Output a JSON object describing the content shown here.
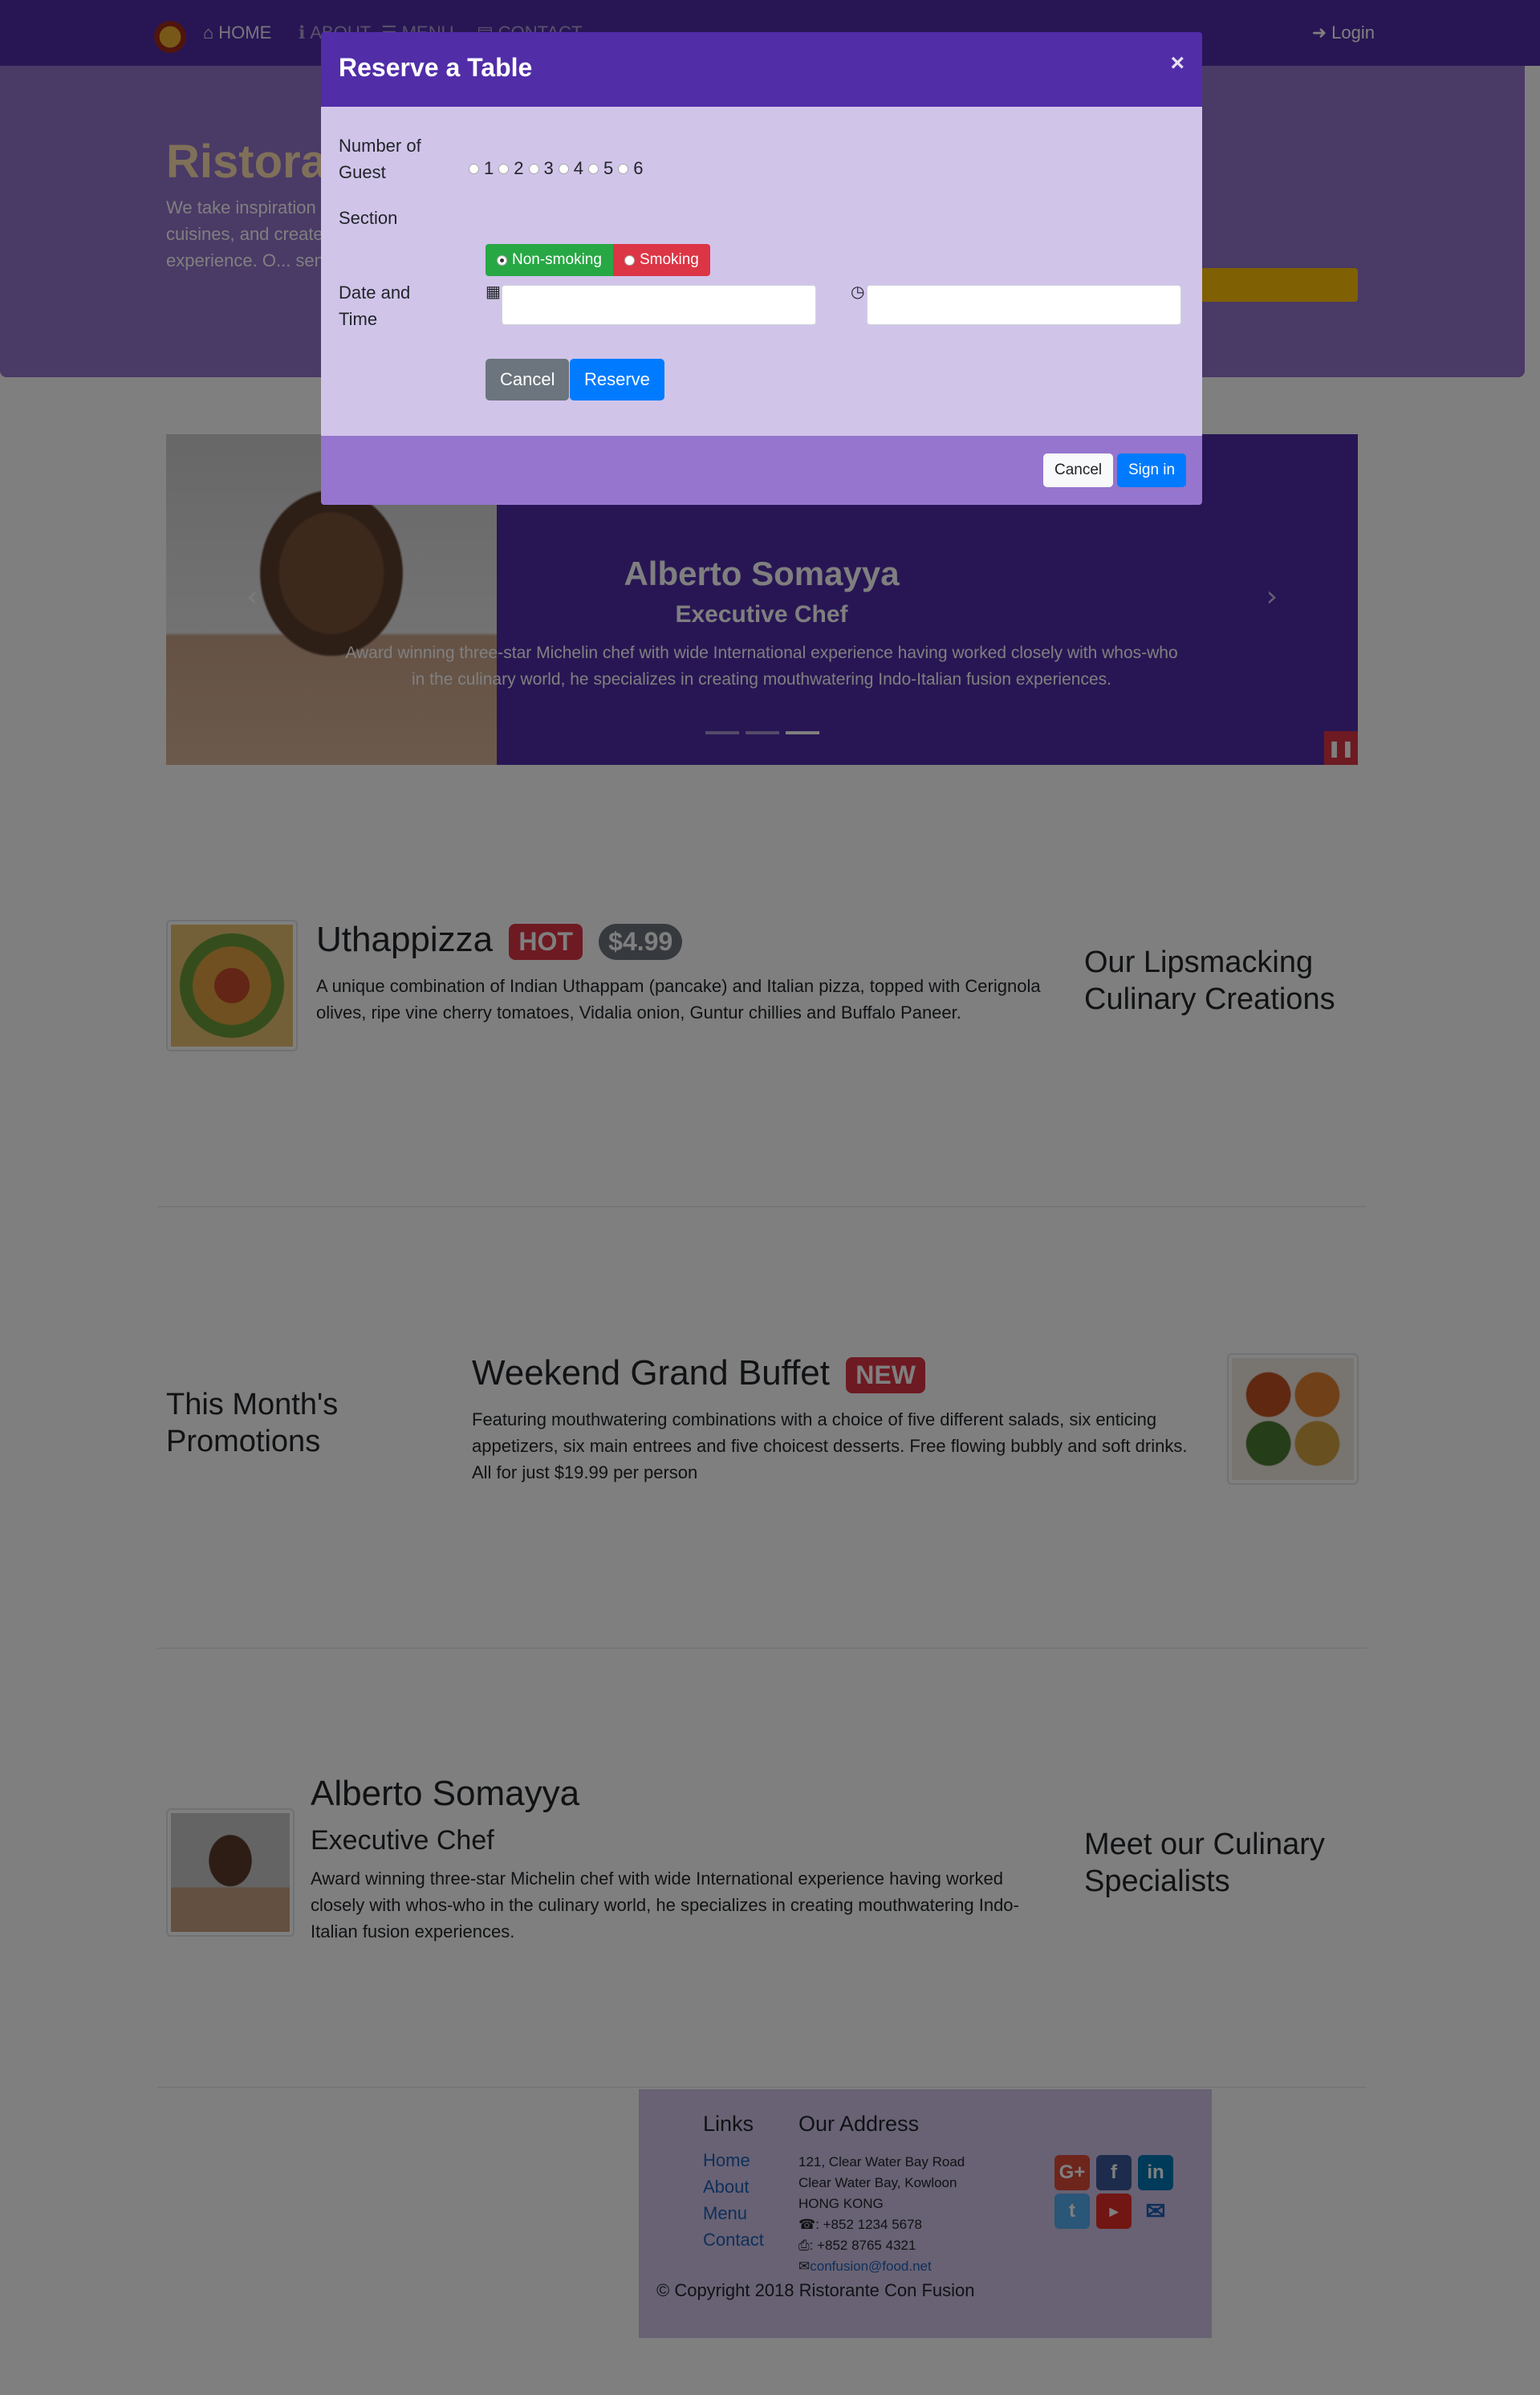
{
  "navbar": {
    "items": [
      {
        "label": "HOME",
        "icon": "home-icon"
      },
      {
        "label": "ABOUT",
        "icon": "info-icon"
      },
      {
        "label": "MENU",
        "icon": "list-icon"
      },
      {
        "label": "CONTACT",
        "icon": "address-card-icon"
      }
    ],
    "login": "Login"
  },
  "jumbotron": {
    "title": "Ristoran",
    "text": "We take inspiration from the World's best cuisines, and create a unique fusion experience. O... senses!"
  },
  "carousel": {
    "name": "Alberto Somayya",
    "role": "Executive Chef",
    "description": "Award winning three-star Michelin chef with wide International experience having worked closely with whos-who in the culinary world, he specializes in creating mouthwatering Indo-Italian fusion experiences.",
    "active_slide_index": 2,
    "slide_count": 3
  },
  "dish": {
    "name": "Uthappizza",
    "badge": "HOT",
    "price": "$4.99",
    "description": "A unique combination of Indian Uthappam (pancake) and Italian pizza, topped with Cerignola olives, ripe vine cherry tomatoes, Vidalia onion, Guntur chillies and Buffalo Paneer.",
    "side_heading": "Our Lipsmacking Culinary Creations"
  },
  "promotion": {
    "side_heading": "This Month's Promotions",
    "name": "Weekend Grand Buffet",
    "badge": "NEW",
    "description": "Featuring mouthwatering combinations with a choice of five different salads, six enticing appetizers, six main entrees and five choicest desserts. Free flowing bubbly and soft drinks. All for just $19.99 per person"
  },
  "leader": {
    "name": "Alberto Somayya",
    "role": "Executive Chef",
    "description": "Award winning three-star Michelin chef with wide International experience having worked closely with whos-who in the culinary world, he specializes in creating mouthwatering Indo-Italian fusion experiences.",
    "side_heading": "Meet our Culinary Specialists"
  },
  "footer": {
    "links_title": "Links",
    "links": [
      "Home",
      "About",
      "Menu",
      "Contact"
    ],
    "address_title": "Our Address",
    "address": [
      "121, Clear Water Bay Road",
      "Clear Water Bay, Kowloon",
      "HONG KONG"
    ],
    "phone": ": +852 1234 5678",
    "fax": ": +852 8765 4321",
    "email": "confusion@food.net",
    "social": [
      "google-plus-icon",
      "facebook-icon",
      "linkedin-icon",
      "twitter-icon",
      "youtube-icon",
      "envelope-icon"
    ],
    "copyright": "© Copyright 2018 Ristorante Con Fusion"
  },
  "modal": {
    "title": "Reserve a Table",
    "close": "×",
    "guests_label": "Number of Guest",
    "guest_options": [
      "1",
      "2",
      "3",
      "4",
      "5",
      "6"
    ],
    "section_label": "Section",
    "section_options": [
      "Non-smoking",
      "Smoking"
    ],
    "section_selected": "Non-smoking",
    "datetime_label": "Date and Time",
    "date_value": "",
    "time_value": "",
    "cancel": "Cancel",
    "reserve": "Reserve",
    "footer_cancel": "Cancel",
    "footer_signin": "Sign in"
  },
  "colors": {
    "primary": "#512da8",
    "light": "#9575cd",
    "lighter": "#d1c4e9",
    "accent": "#ffc107"
  }
}
